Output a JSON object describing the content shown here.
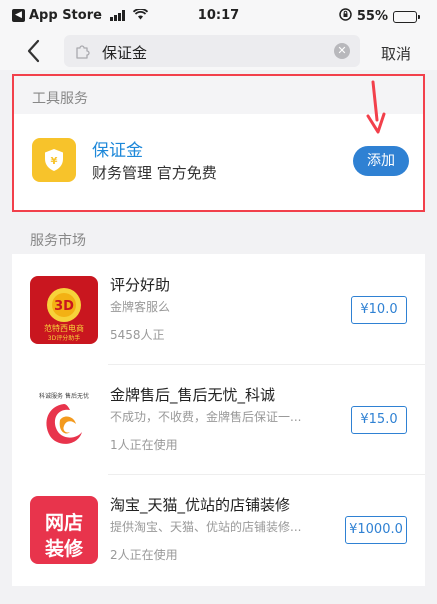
{
  "status_bar": {
    "back_app": "App Store",
    "time": "10:17",
    "battery": "55%",
    "battery_level": 0.55
  },
  "nav": {
    "search_text": "保证金",
    "cancel_label": "取消"
  },
  "tool_section": {
    "header": "工具服务",
    "item": {
      "title": "保证金",
      "desc": "财务管理 官方免费",
      "add_label": "添加"
    }
  },
  "market_section": {
    "header": "服务市场",
    "items": [
      {
        "title": "评分好助",
        "desc": "金牌客服么",
        "users": "5458人正",
        "price": "¥10.0",
        "icon_text_top": "范特西电商",
        "icon_text_bottom": "3D评分助手"
      },
      {
        "title": "金牌售后_售后无忧_科诚",
        "desc": "不成功，不收费，金牌售后保证一...",
        "users": "1人正在使用",
        "price": "¥15.0",
        "icon_text_top": "科诚服务 售后无忧"
      },
      {
        "title": "淘宝_天猫_优站的店铺装修",
        "desc": "提供淘宝、天猫、优站的店铺装修...",
        "users": "2人正在使用",
        "price": "¥1000.0",
        "icon_text_top": "网店",
        "icon_text_bottom": "装修"
      }
    ]
  },
  "colors": {
    "accent": "#2f81d3",
    "highlight_border": "#f2404b",
    "tool_icon_bg": "#f7c32b",
    "decor_icon_bg": "#e8344c"
  }
}
